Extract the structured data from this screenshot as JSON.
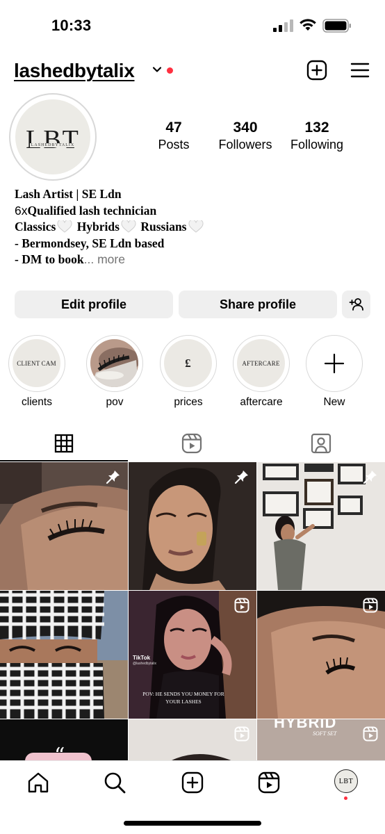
{
  "status_bar": {
    "time": "10:33"
  },
  "header": {
    "username": "lashedbytalix"
  },
  "profile": {
    "avatar": {
      "monogram": "LBT",
      "subtitle": "LASHEDBYTALIX"
    },
    "stats": [
      {
        "count": "47",
        "label": "Posts"
      },
      {
        "count": "340",
        "label": "Followers"
      },
      {
        "count": "132",
        "label": "Following"
      }
    ],
    "bio": {
      "line1": "Lash Artist | SE Ldn",
      "line2_prefix": "6x",
      "line2_rest": "Qualified lash technician",
      "line3_parts": [
        "Classics",
        "Hybrids",
        "Russians"
      ],
      "line4": "- Bermondsey, SE Ldn based",
      "line5": "- DM to book",
      "more": "... more"
    }
  },
  "actions": {
    "edit": "Edit profile",
    "share": "Share profile"
  },
  "highlights": [
    {
      "cover_text": "CLIENT CAM",
      "label": "clients"
    },
    {
      "cover_text": "",
      "label": "pov"
    },
    {
      "cover_text": "£",
      "label": "prices"
    },
    {
      "cover_text": "AFTERCARE",
      "label": "aftercare"
    },
    {
      "cover_text": "",
      "label": "New"
    }
  ],
  "tabs": [
    "grid-icon",
    "reels-icon",
    "tagged-icon"
  ],
  "grid": {
    "posts": [
      {
        "type": "pinned",
        "overlay": ""
      },
      {
        "type": "pinned",
        "overlay": ""
      },
      {
        "type": "pinned",
        "overlay": ""
      },
      {
        "type": "photo",
        "overlay": ""
      },
      {
        "type": "reel",
        "overlay": "POV: HE SENDS YOU MONEY FOR YOUR LASHES",
        "watermark": "TikTok",
        "handle": "@lashedbytalix"
      },
      {
        "type": "reel",
        "overlay": ""
      },
      {
        "type": "photo",
        "overlay": ""
      },
      {
        "type": "reel",
        "overlay": ""
      },
      {
        "type": "reel",
        "overlay": "HYBRID",
        "sub": "SOFT SET"
      }
    ]
  },
  "bottom_nav": {
    "profile_monogram": "LBT"
  },
  "colors": {
    "accent_red": "#ff3040",
    "button_bg": "#efefef",
    "muted_text": "#737373"
  }
}
